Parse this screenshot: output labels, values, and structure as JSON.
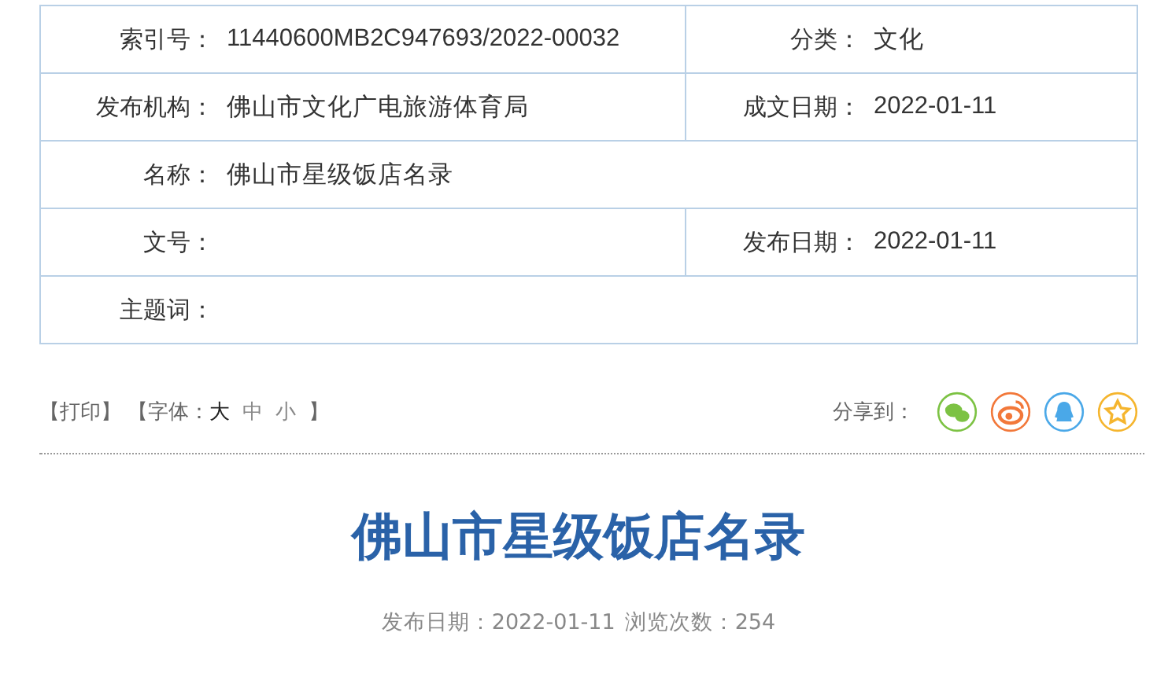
{
  "info_table": {
    "rows": [
      {
        "cells": [
          {
            "label": "索引号：",
            "value": "11440600MB2C947693/2022-00032"
          },
          {
            "label": "分类：",
            "value": "文化"
          }
        ]
      },
      {
        "cells": [
          {
            "label": "发布机构：",
            "value": "佛山市文化广电旅游体育局"
          },
          {
            "label": "成文日期：",
            "value": "2022-01-11"
          }
        ]
      },
      {
        "cells": [
          {
            "label": "名称：",
            "value": "佛山市星级饭店名录"
          }
        ]
      },
      {
        "cells": [
          {
            "label": "文号："
          },
          {
            "label": "发布日期：",
            "value": "2022-01-11"
          }
        ]
      },
      {
        "cells": [
          {
            "label": "主题词："
          }
        ]
      }
    ]
  },
  "toolbar": {
    "print": "【打印】",
    "font_size": {
      "prefix": "【字体：",
      "options": [
        {
          "label": "大",
          "selected": true
        },
        {
          "label": "中",
          "selected": false
        },
        {
          "label": "小",
          "selected": false
        }
      ],
      "suffix": "】"
    },
    "share": {
      "label": "分享到：",
      "targets": [
        {
          "kind": "chat",
          "color": "#7cc243"
        },
        {
          "kind": "eye",
          "color": "#f2783a"
        },
        {
          "kind": "figure",
          "color": "#4aa8e8"
        },
        {
          "kind": "star",
          "color": "#f5b52e"
        }
      ]
    }
  },
  "article": {
    "title": "佛山市星级饭店名录",
    "publish_date": "发布日期：2022-01-11",
    "views": "浏览次数：254"
  }
}
